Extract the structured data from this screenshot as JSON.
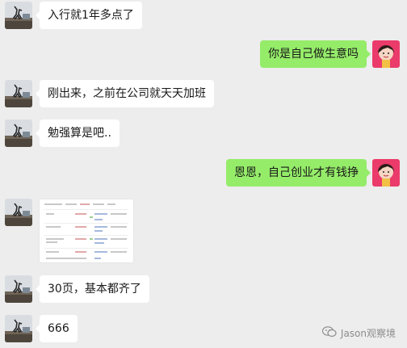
{
  "messages": [
    {
      "side": "left",
      "text": "入行就1年多点了"
    },
    {
      "side": "right",
      "text": "你是自己做生意吗"
    },
    {
      "side": "left",
      "text": "刚出来，之前在公司就天天加班"
    },
    {
      "side": "left",
      "text": "勉强算是吧.."
    },
    {
      "side": "right",
      "text": "恩恩，自己创业才有钱挣"
    },
    {
      "side": "left",
      "type": "image"
    },
    {
      "side": "left",
      "text": "30页，基本都齐了"
    },
    {
      "side": "left",
      "text": "666"
    }
  ],
  "watermark": {
    "text": "Jason观察境",
    "icon": "wechat-official-account-icon"
  },
  "colors": {
    "background": "#ededed",
    "bubble_left": "#ffffff",
    "bubble_right": "#95ec69",
    "text": "#191919"
  }
}
